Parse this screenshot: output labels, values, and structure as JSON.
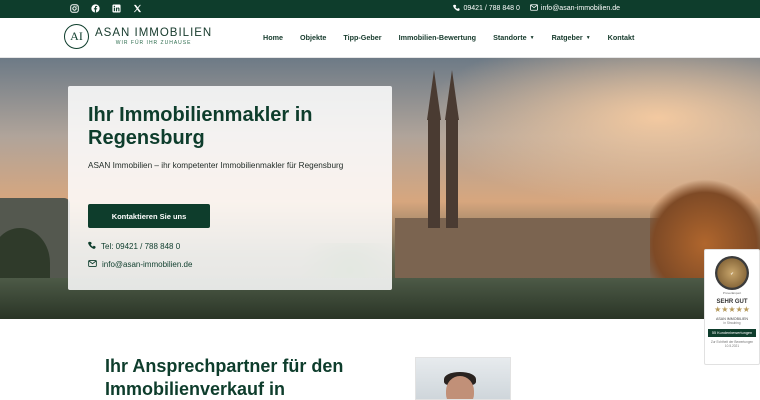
{
  "topbar": {
    "social_icons": [
      "instagram-icon",
      "facebook-icon",
      "linkedin-icon",
      "x-icon"
    ],
    "phone": "09421 / 788 848 0",
    "email": "info@asan-immobilien.de"
  },
  "header": {
    "logo_mark": "AI",
    "brand_name": "ASAN IMMOBILIEN",
    "tagline": "WIR FÜR IHR ZUHAUSE",
    "nav": [
      {
        "label": "Home"
      },
      {
        "label": "Objekte"
      },
      {
        "label": "Tipp-Geber"
      },
      {
        "label": "Immobilien-Bewertung"
      },
      {
        "label": "Standorte",
        "dropdown": true
      },
      {
        "label": "Ratgeber",
        "dropdown": true
      },
      {
        "label": "Kontakt"
      }
    ]
  },
  "hero": {
    "title": "Ihr Immobilienmakler in Regensburg",
    "subtitle": "ASAN Immobilien – ihr kompetenter Immobilienmakler für Regensburg",
    "cta_label": "Kontaktieren Sie uns",
    "phone_line": "Tel: 09421 / 788 848 0",
    "email_line": "info@asan-immobilien.de"
  },
  "badge": {
    "seal_text": "ProvenExpert",
    "rating": "SEHR GUT",
    "stars": "★★★★★",
    "company": "ASAN IMMOBILIEN",
    "location": "in Straubing",
    "count": "55 Kundenbewertungen",
    "footer": "Zur Echtheit der Bewertungen",
    "date": "10.5.2021"
  },
  "section": {
    "title": "Ihr Ansprechpartner für den Immobilienverkauf in"
  },
  "colors": {
    "brand_green": "#0e3d2c",
    "star_gold": "#b69a5c"
  }
}
